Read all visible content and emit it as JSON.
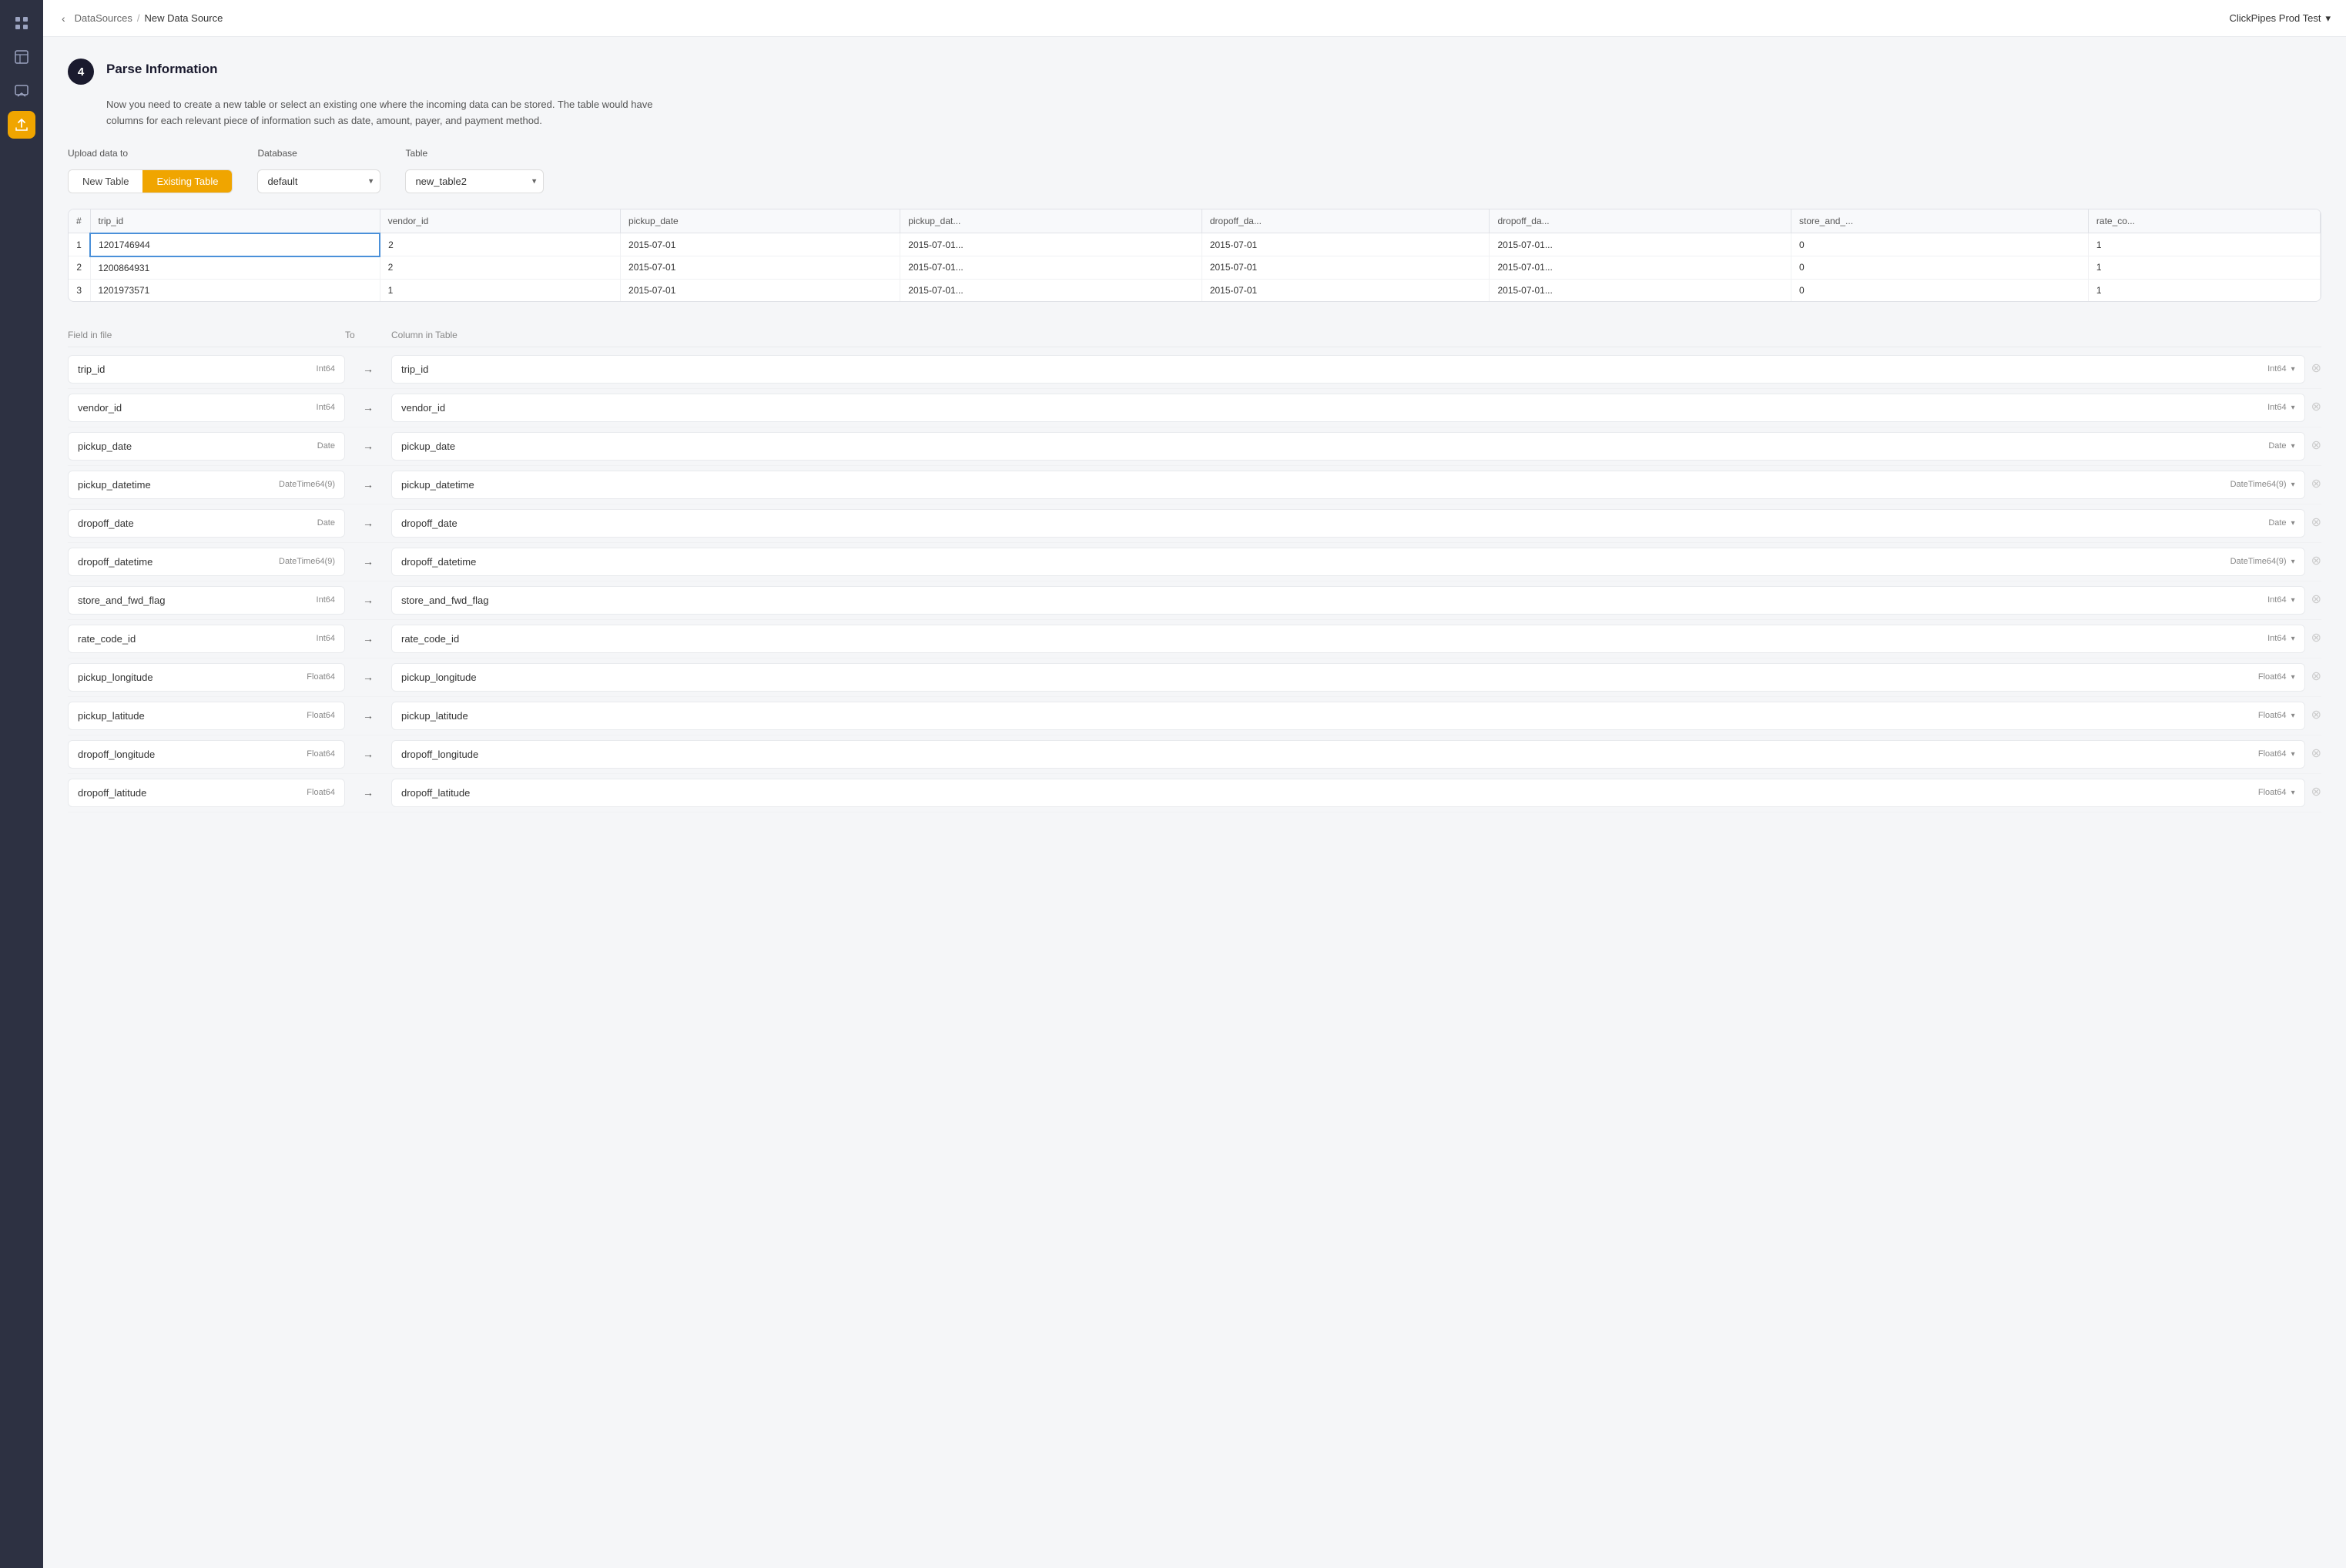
{
  "app": {
    "title": "ClickPipes Prod Test"
  },
  "breadcrumb": {
    "parent": "DataSources",
    "separator": "/",
    "current": "New Data Source"
  },
  "step": {
    "number": "4",
    "title": "Parse Information",
    "description": "Now you need to create a new table or select an existing one where the incoming data can be stored. The table would have columns for each relevant piece of information such as date, amount, payer, and payment method."
  },
  "upload": {
    "label": "Upload data to",
    "options": [
      "New Table",
      "Existing Table"
    ],
    "active": "Existing Table"
  },
  "database": {
    "label": "Database",
    "value": "default",
    "options": [
      "default"
    ]
  },
  "table_select": {
    "label": "Table",
    "value": "new_table2",
    "options": [
      "new_table2"
    ]
  },
  "preview_table": {
    "columns": [
      "#",
      "trip_id",
      "vendor_id",
      "pickup_date",
      "pickup_dat...",
      "dropoff_da...",
      "dropoff_da...",
      "store_and_...",
      "rate_co..."
    ],
    "rows": [
      [
        "1",
        "1201746944",
        "2",
        "2015-07-01",
        "2015-07-01...",
        "2015-07-01",
        "2015-07-01...",
        "0",
        "1"
      ],
      [
        "2",
        "1200864931",
        "2",
        "2015-07-01",
        "2015-07-01...",
        "2015-07-01",
        "2015-07-01...",
        "0",
        "1"
      ],
      [
        "3",
        "1201973571",
        "1",
        "2015-07-01",
        "2015-07-01...",
        "2015-07-01",
        "2015-07-01...",
        "0",
        "1"
      ]
    ]
  },
  "mapping": {
    "header_left": "Field in file",
    "header_arrow": "To",
    "header_right": "Column in Table",
    "fields": [
      {
        "name": "trip_id",
        "type": "Int64",
        "col_name": "trip_id",
        "col_type": "Int64"
      },
      {
        "name": "vendor_id",
        "type": "Int64",
        "col_name": "vendor_id",
        "col_type": "Int64"
      },
      {
        "name": "pickup_date",
        "type": "Date",
        "col_name": "pickup_date",
        "col_type": "Date"
      },
      {
        "name": "pickup_datetime",
        "type": "DateTime64(9)",
        "col_name": "pickup_datetime",
        "col_type": "DateTime64(9)"
      },
      {
        "name": "dropoff_date",
        "type": "Date",
        "col_name": "dropoff_date",
        "col_type": "Date"
      },
      {
        "name": "dropoff_datetime",
        "type": "DateTime64(9)",
        "col_name": "dropoff_datetime",
        "col_type": "DateTime64(9)"
      },
      {
        "name": "store_and_fwd_flag",
        "type": "Int64",
        "col_name": "store_and_fwd_flag",
        "col_type": "Int64"
      },
      {
        "name": "rate_code_id",
        "type": "Int64",
        "col_name": "rate_code_id",
        "col_type": "Int64"
      },
      {
        "name": "pickup_longitude",
        "type": "Float64",
        "col_name": "pickup_longitude",
        "col_type": "Float64"
      },
      {
        "name": "pickup_latitude",
        "type": "Float64",
        "col_name": "pickup_latitude",
        "col_type": "Float64"
      },
      {
        "name": "dropoff_longitude",
        "type": "Float64",
        "col_name": "dropoff_longitude",
        "col_type": "Float64"
      },
      {
        "name": "dropoff_latitude",
        "type": "Float64",
        "col_name": "dropoff_latitude",
        "col_type": "Float64"
      }
    ]
  },
  "sidebar": {
    "icons": [
      {
        "name": "grid-icon",
        "symbol": "⊞",
        "active": false
      },
      {
        "name": "table-icon",
        "symbol": "▦",
        "active": false
      },
      {
        "name": "message-icon",
        "symbol": "✉",
        "active": false
      },
      {
        "name": "upload-icon",
        "symbol": "⬆",
        "active": true
      }
    ]
  }
}
